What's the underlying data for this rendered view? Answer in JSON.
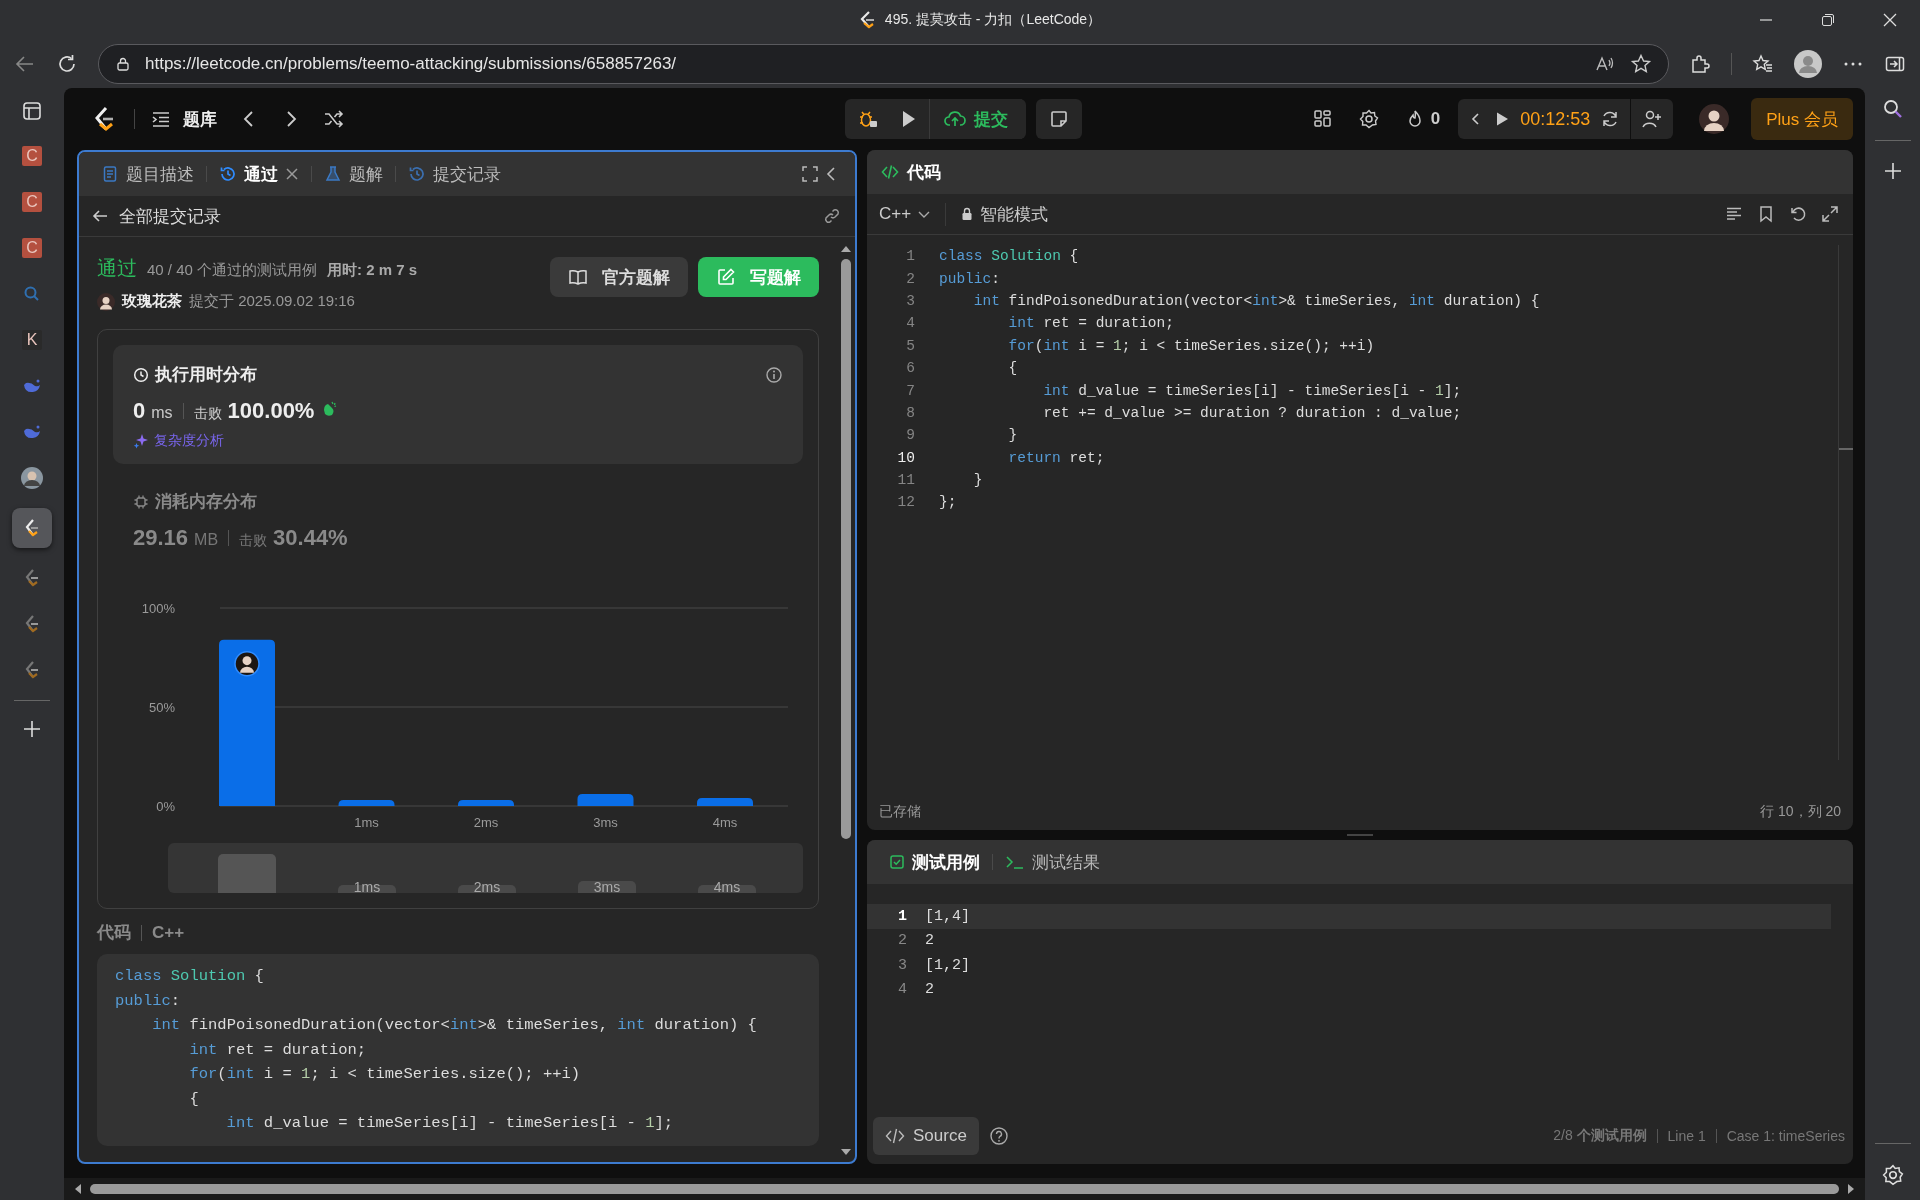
{
  "browser": {
    "title": "495. 提莫攻击 - 力扣（LeetCode）",
    "url": "https://leetcode.cn/problems/teemo-attacking/submissions/658857263/"
  },
  "browser_sidebar": [
    {
      "kind": "letter",
      "glyph": "C",
      "color": "#b4503f",
      "selected": false
    },
    {
      "kind": "letter",
      "glyph": "C",
      "color": "#b4503f",
      "selected": false
    },
    {
      "kind": "letter",
      "glyph": "C",
      "color": "#b4503f",
      "selected": false
    },
    {
      "kind": "search",
      "selected": false
    },
    {
      "kind": "letter",
      "glyph": "K",
      "color": "#2a2a2a",
      "selected": false
    },
    {
      "kind": "whale",
      "selected": false
    },
    {
      "kind": "whale",
      "selected": false
    },
    {
      "kind": "avatar",
      "selected": false
    },
    {
      "kind": "leetcode",
      "selected": true
    },
    {
      "kind": "leetcode",
      "selected": false
    },
    {
      "kind": "leetcode",
      "selected": false
    },
    {
      "kind": "leetcode",
      "selected": false
    }
  ],
  "topbar": {
    "problem_list": "题库",
    "submit": "提交",
    "streak": "0",
    "timer": "00:12:53",
    "plus": "Plus 会员"
  },
  "left_panel": {
    "tabs": [
      {
        "label": "题目描述",
        "kind": "doc",
        "selected": false,
        "closable": false
      },
      {
        "label": "通过",
        "kind": "history",
        "selected": true,
        "closable": true
      },
      {
        "label": "题解",
        "kind": "flask",
        "selected": false,
        "closable": false
      },
      {
        "label": "提交记录",
        "kind": "history",
        "selected": false,
        "closable": false
      }
    ],
    "back": "全部提交记录",
    "submission": {
      "status": "通过",
      "cases": "40 / 40 个通过的测试用例",
      "elapsed": "用时: 2 m 7 s",
      "user": "玫瑰花茶",
      "submitted": "提交于 2025.09.02 19:16"
    },
    "buttons": [
      {
        "label": "官方题解",
        "kind": "book"
      },
      {
        "label": "写题解",
        "kind": "write"
      }
    ],
    "stats": [
      {
        "kind": "time",
        "title": "执行用时分布",
        "value": "0",
        "unit": "ms",
        "beat_label": "击败",
        "beat": "100.00%",
        "link": "复杂度分析",
        "selected": true
      },
      {
        "kind": "memory",
        "title": "消耗内存分布",
        "value": "29.16",
        "unit": "MB",
        "beat_label": "击败",
        "beat": "30.44%",
        "selected": false
      }
    ],
    "chart_data": {
      "type": "bar",
      "categories": [
        null,
        "1ms",
        "2ms",
        "3ms",
        "4ms"
      ],
      "values": [
        84,
        3,
        3,
        6,
        4
      ],
      "ylim": [
        0,
        100
      ],
      "yticks": [
        {
          "value": 0,
          "label": "0%"
        },
        {
          "value": 50,
          "label": "50%"
        },
        {
          "value": 100,
          "label": "100%"
        }
      ]
    },
    "brush_labels": [
      "1ms",
      "2ms",
      "3ms",
      "4ms"
    ],
    "code": {
      "label": "代码",
      "language": "C++",
      "lines": [
        [
          {
            "kind": "keyword",
            "t": "class"
          },
          {
            "kind": "type",
            "t": " Solution"
          },
          {
            "kind": "plain",
            "t": " {"
          }
        ],
        [
          {
            "kind": "keyword",
            "t": "public"
          },
          {
            "kind": "plain",
            "t": ":"
          }
        ],
        [
          {
            "kind": "keyword",
            "t": "    int"
          },
          {
            "kind": "plain",
            "t": " findPoisonedDuration(vector<"
          },
          {
            "kind": "keyword",
            "t": "int"
          },
          {
            "kind": "plain",
            "t": ">& timeSeries, "
          },
          {
            "kind": "keyword",
            "t": "int"
          },
          {
            "kind": "plain",
            "t": " duration) {"
          }
        ],
        [
          {
            "kind": "keyword",
            "t": "        int"
          },
          {
            "kind": "plain",
            "t": " ret = duration;"
          }
        ],
        [
          {
            "kind": "keyword",
            "t": "        for"
          },
          {
            "kind": "plain",
            "t": "("
          },
          {
            "kind": "keyword",
            "t": "int"
          },
          {
            "kind": "plain",
            "t": " i = "
          },
          {
            "kind": "number",
            "t": "1"
          },
          {
            "kind": "plain",
            "t": "; i < timeSeries.size(); ++i)"
          }
        ],
        [
          {
            "kind": "plain",
            "t": "        {"
          }
        ],
        [
          {
            "kind": "keyword",
            "t": "            int"
          },
          {
            "kind": "plain",
            "t": " d_value = timeSeries[i] - timeSeries[i - "
          },
          {
            "kind": "number",
            "t": "1"
          },
          {
            "kind": "plain",
            "t": "];"
          }
        ]
      ]
    }
  },
  "editor": {
    "title": "代码",
    "language": "C++",
    "mode": "智能模式",
    "saved": "已存储",
    "cursor": "行 10，列 20",
    "lines": [
      {
        "n": "1",
        "active": false,
        "tokens": [
          {
            "kind": "keyword",
            "t": "class"
          },
          {
            "kind": "type",
            "t": " Solution"
          },
          {
            "kind": "plain",
            "t": " {"
          }
        ]
      },
      {
        "n": "2",
        "active": false,
        "tokens": [
          {
            "kind": "keyword",
            "t": "public"
          },
          {
            "kind": "plain",
            "t": ":"
          }
        ]
      },
      {
        "n": "3",
        "active": false,
        "tokens": [
          {
            "kind": "keyword",
            "t": "    int"
          },
          {
            "kind": "plain",
            "t": " findPoisonedDuration(vector<"
          },
          {
            "kind": "keyword",
            "t": "int"
          },
          {
            "kind": "plain",
            "t": ">& timeSeries, "
          },
          {
            "kind": "keyword",
            "t": "int"
          },
          {
            "kind": "plain",
            "t": " duration) {"
          }
        ]
      },
      {
        "n": "4",
        "active": false,
        "tokens": [
          {
            "kind": "keyword",
            "t": "        int"
          },
          {
            "kind": "plain",
            "t": " ret = duration;"
          }
        ]
      },
      {
        "n": "5",
        "active": false,
        "tokens": [
          {
            "kind": "keyword",
            "t": "        for"
          },
          {
            "kind": "plain",
            "t": "("
          },
          {
            "kind": "keyword",
            "t": "int"
          },
          {
            "kind": "plain",
            "t": " i = "
          },
          {
            "kind": "number",
            "t": "1"
          },
          {
            "kind": "plain",
            "t": "; i < timeSeries.size(); ++i)"
          }
        ]
      },
      {
        "n": "6",
        "active": false,
        "tokens": [
          {
            "kind": "plain",
            "t": "        {"
          }
        ]
      },
      {
        "n": "7",
        "active": false,
        "tokens": [
          {
            "kind": "keyword",
            "t": "            int"
          },
          {
            "kind": "plain",
            "t": " d_value = timeSeries[i] - timeSeries[i - "
          },
          {
            "kind": "number",
            "t": "1"
          },
          {
            "kind": "plain",
            "t": "];"
          }
        ]
      },
      {
        "n": "8",
        "active": false,
        "tokens": [
          {
            "kind": "plain",
            "t": "            ret += d_value >= duration ? duration : d_value;"
          }
        ]
      },
      {
        "n": "9",
        "active": false,
        "tokens": [
          {
            "kind": "plain",
            "t": "        }"
          }
        ]
      },
      {
        "n": "10",
        "active": true,
        "tokens": [
          {
            "kind": "keyword",
            "t": "        return"
          },
          {
            "kind": "plain",
            "t": " ret;"
          }
        ]
      },
      {
        "n": "11",
        "active": false,
        "tokens": [
          {
            "kind": "plain",
            "t": "    }"
          }
        ]
      },
      {
        "n": "12",
        "active": false,
        "tokens": [
          {
            "kind": "plain",
            "t": "};"
          }
        ]
      }
    ]
  },
  "testcase": {
    "tabs": [
      {
        "label": "测试用例",
        "kind": "check",
        "selected": true
      },
      {
        "label": "测试结果",
        "kind": "terminal",
        "selected": false
      }
    ],
    "lines": [
      {
        "n": "1",
        "text": "[1,4]",
        "active": true
      },
      {
        "n": "2",
        "text": "2",
        "active": false
      },
      {
        "n": "3",
        "text": "[1,2]",
        "active": false
      },
      {
        "n": "4",
        "text": "2",
        "active": false
      }
    ],
    "source_button": "Source",
    "footer": [
      "2/8 **个测试用例**",
      "Line 1",
      "Case 1: timeSeries"
    ]
  }
}
